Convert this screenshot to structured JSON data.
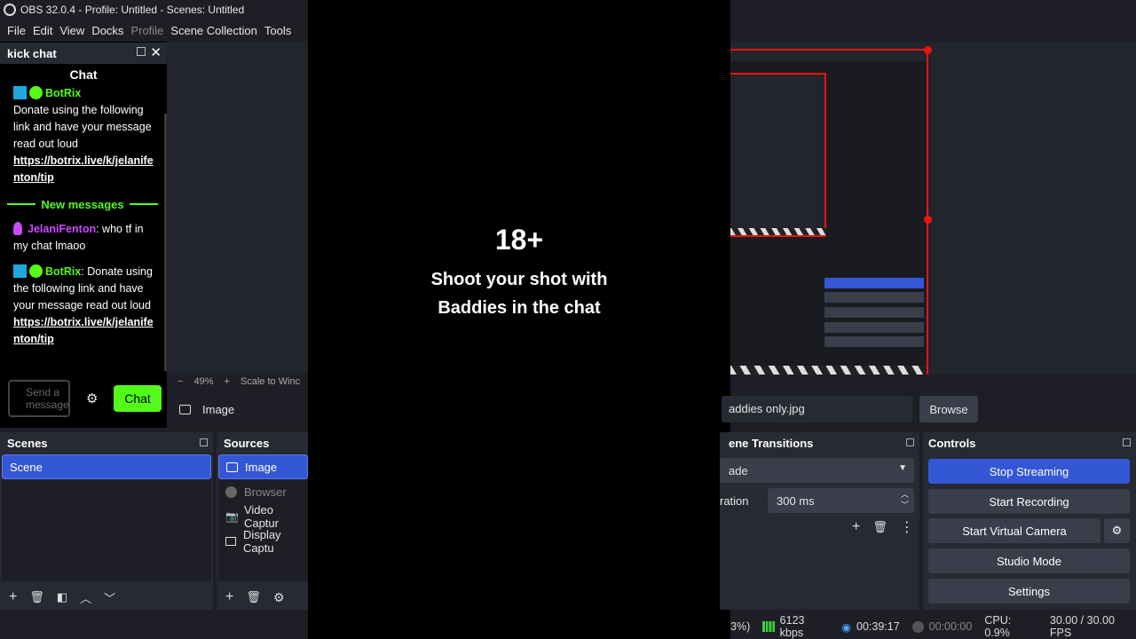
{
  "window": {
    "title": "OBS 32.0.4 - Profile: Untitled - Scenes: Untitled",
    "minimize": "—",
    "maximize": "❐",
    "close": "✕"
  },
  "menu": [
    "File",
    "Edit",
    "View",
    "Docks",
    "Profile",
    "Scene Collection",
    "Tools"
  ],
  "kick_chat": {
    "dock_title": "kick chat",
    "chat_title": "Chat",
    "messages": [
      {
        "user": "BotRix",
        "text": "Donate using the following link and have your message read out loud",
        "link": "https://botrix.live/k/jelanifenton/tip"
      },
      {
        "user": "JelaniFenton",
        "text": "who tf in my chat lmaoo"
      },
      {
        "user": "BotRix",
        "text": "Donate using the following link and have your message read out loud",
        "link": "https://botrix.live/k/jelanifenton/tip"
      }
    ],
    "new_messages": "New messages",
    "send_placeholder_1": "Send a",
    "send_placeholder_2": "message",
    "chat_button": "Chat"
  },
  "preview": {
    "zoom": "49%",
    "scale_mode": "Scale to Winc",
    "selected_source": "Image"
  },
  "scenes": {
    "title": "Scenes",
    "items": [
      "Scene"
    ]
  },
  "sources": {
    "title": "Sources",
    "items": [
      "Image",
      "Browser",
      "Video Captur",
      "Display Captu"
    ]
  },
  "video_overlay": {
    "headline": "18+",
    "line1": "Shoot your shot with",
    "line2": "Baddies in the chat"
  },
  "image_props": {
    "filename": "addies only.jpg",
    "browse": "Browse"
  },
  "transitions": {
    "title": "ene Transitions",
    "type": "ade",
    "duration_label": "ration",
    "duration_value": "300 ms"
  },
  "controls": {
    "title": "Controls",
    "stop_streaming": "Stop Streaming",
    "start_recording": "Start Recording",
    "start_virtual_camera": "Start Virtual Camera",
    "studio_mode": "Studio Mode",
    "settings": "Settings"
  },
  "status": {
    "dropped": "3%)",
    "bitrate": "6123 kbps",
    "stream_time": "00:39:17",
    "rec_time": "00:00:00",
    "cpu": "CPU: 0.9%",
    "fps": "30.00 / 30.00 FPS"
  },
  "colors": {
    "kick_green": "#53fc18",
    "obs_blue": "#3457d5",
    "preview_red": "#ee1111"
  }
}
